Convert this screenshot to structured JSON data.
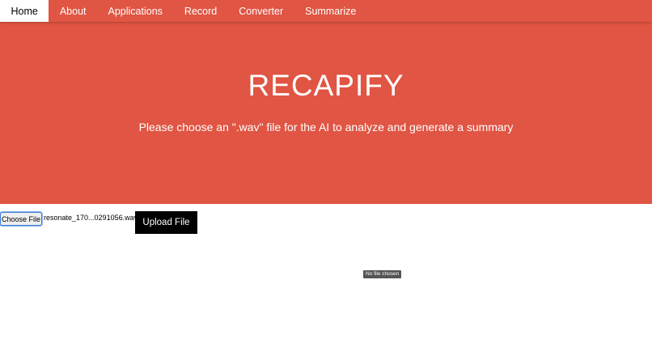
{
  "nav": {
    "items": [
      {
        "label": "Home",
        "active": true
      },
      {
        "label": "About",
        "active": false
      },
      {
        "label": "Applications",
        "active": false
      },
      {
        "label": "Record",
        "active": false
      },
      {
        "label": "Converter",
        "active": false
      },
      {
        "label": "Summarize",
        "active": false
      }
    ]
  },
  "hero": {
    "title": "RECAPIFY",
    "subtitle": "Please choose an \".wav\" file for the AI to analyze and generate a summary"
  },
  "upload": {
    "choose_label": "Choose File",
    "file_name": "resonate_170...0291056.wav",
    "upload_label": "Upload File"
  },
  "tooltip": {
    "text": "No file chosen"
  },
  "colors": {
    "brand": "#e05543",
    "nav_active_bg": "#ffffff",
    "upload_button_bg": "#000000",
    "focus_ring": "#3b7bd8"
  }
}
